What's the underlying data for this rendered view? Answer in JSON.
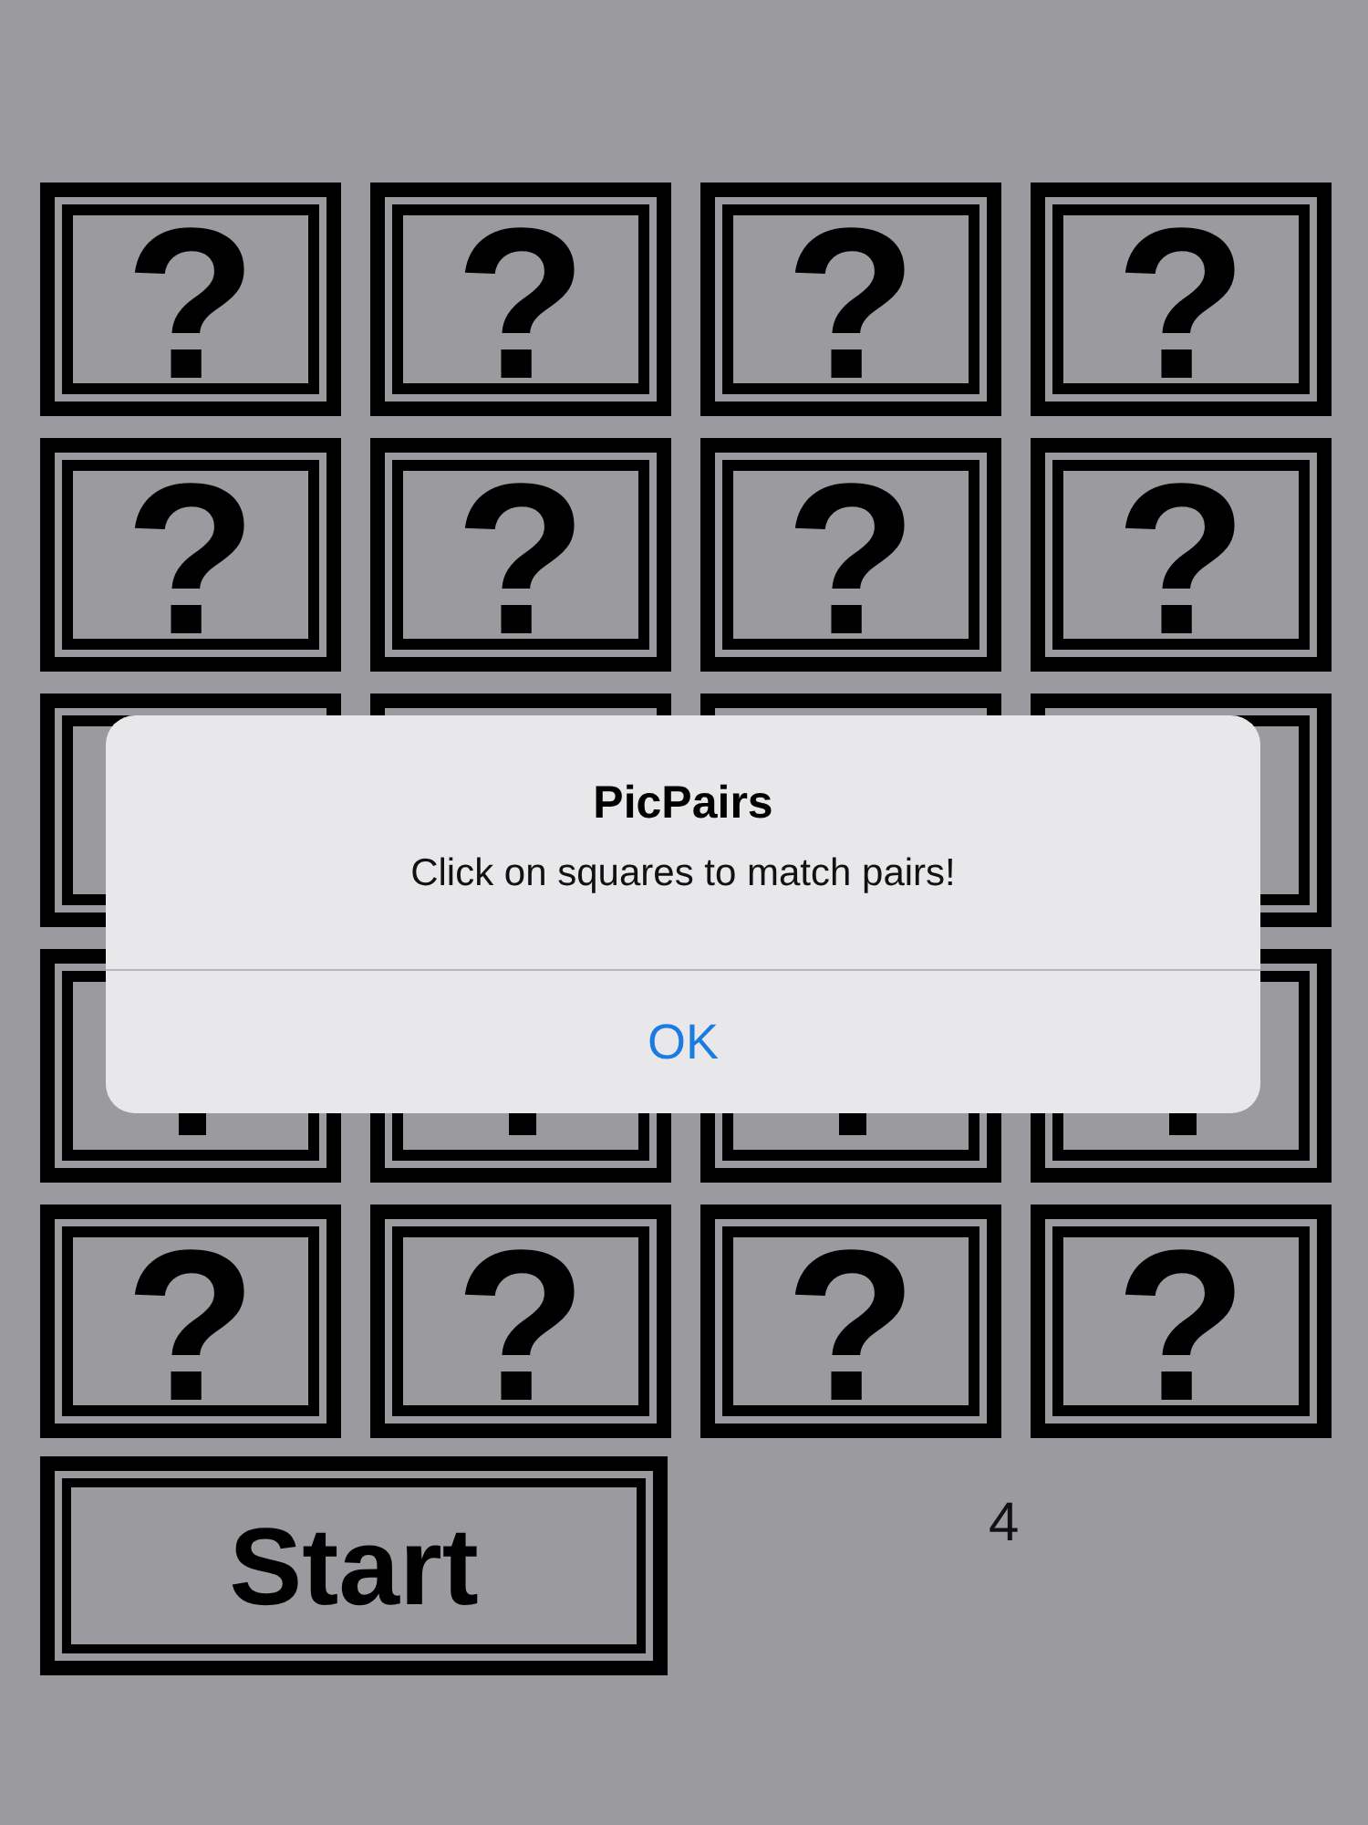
{
  "cards": [
    {
      "label": "?"
    },
    {
      "label": "?"
    },
    {
      "label": "?"
    },
    {
      "label": "?"
    },
    {
      "label": "?"
    },
    {
      "label": "?"
    },
    {
      "label": "?"
    },
    {
      "label": "?"
    },
    {
      "kind": "covered"
    },
    {
      "kind": "covered"
    },
    {
      "kind": "covered"
    },
    {
      "kind": "covered"
    },
    {
      "kind": "covered"
    },
    {
      "kind": "covered"
    },
    {
      "kind": "covered"
    },
    {
      "kind": "covered"
    },
    {
      "label": "?"
    },
    {
      "label": "?"
    },
    {
      "label": "?"
    },
    {
      "label": "?"
    }
  ],
  "start_button": {
    "label": "Start"
  },
  "count": "4",
  "alert": {
    "title": "PicPairs",
    "message": "Click on squares to match pairs!",
    "button": "OK"
  }
}
